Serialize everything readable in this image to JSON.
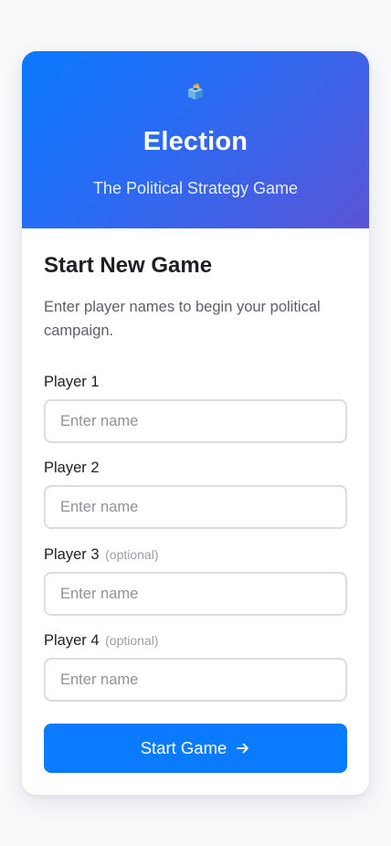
{
  "header": {
    "icon": "ballot-box-icon",
    "title": "Election",
    "subtitle": "The Political Strategy Game"
  },
  "form": {
    "title": "Start New Game",
    "intro": "Enter player names to begin your political campaign.",
    "players": [
      {
        "label": "Player 1",
        "optional": "",
        "placeholder": "Enter name",
        "value": ""
      },
      {
        "label": "Player 2",
        "optional": "",
        "placeholder": "Enter name",
        "value": ""
      },
      {
        "label": "Player 3",
        "optional": "(optional)",
        "placeholder": "Enter name",
        "value": ""
      },
      {
        "label": "Player 4",
        "optional": "(optional)",
        "placeholder": "Enter name",
        "value": ""
      }
    ],
    "submit_label": "Start Game",
    "submit_icon": "arrow-right-icon"
  },
  "colors": {
    "accent": "#0a7aff",
    "gradient_end": "#5a55d6",
    "background": "#f8f9fb"
  }
}
